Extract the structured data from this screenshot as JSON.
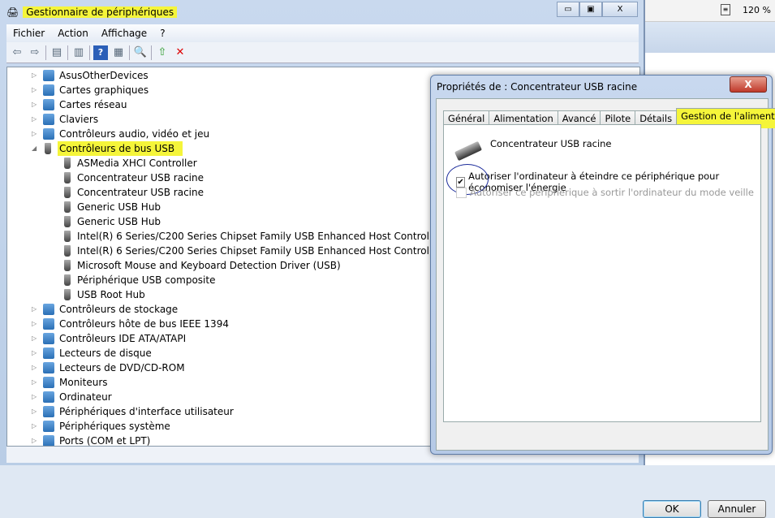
{
  "background": {
    "zoom_level": "120 %"
  },
  "window": {
    "title": "Gestionnaire de périphériques",
    "controls": [
      "minimize",
      "maximize",
      "close"
    ]
  },
  "menu": [
    "Fichier",
    "Action",
    "Affichage",
    "?"
  ],
  "toolbar": [
    "back-icon",
    "forward-icon",
    "show-hide-console-tree-icon",
    "properties-icon",
    "help-icon",
    "action-pane-icon",
    "scan-hardware-icon",
    "update-driver-icon",
    "uninstall-icon"
  ],
  "tree": {
    "before": [
      "AsusOtherDevices",
      "Cartes graphiques",
      "Cartes réseau",
      "Claviers",
      "Contrôleurs audio, vidéo et jeu"
    ],
    "expanded": "Contrôleurs de bus USB",
    "children": [
      "ASMedia XHCI Controller",
      "Concentrateur USB racine",
      "Concentrateur USB racine",
      "Generic USB Hub",
      "Generic USB Hub",
      "Intel(R) 6 Series/C200 Series Chipset Family USB Enhanced Host Controller - 1C26",
      "Intel(R) 6 Series/C200 Series Chipset Family USB Enhanced Host Controller - 1C2D",
      "Microsoft Mouse and Keyboard Detection Driver (USB)",
      "Périphérique USB composite",
      "USB Root Hub"
    ],
    "after": [
      "Contrôleurs de stockage",
      "Contrôleurs hôte de bus IEEE 1394",
      "Contrôleurs IDE ATA/ATAPI",
      "Lecteurs de disque",
      "Lecteurs de DVD/CD-ROM",
      "Moniteurs",
      "Ordinateur",
      "Périphériques d'interface utilisateur",
      "Périphériques système",
      "Ports (COM et LPT)"
    ]
  },
  "dialog": {
    "title": "Propriétés de : Concentrateur USB racine",
    "close": "X",
    "tabs": [
      "Général",
      "Alimentation",
      "Avancé",
      "Pilote",
      "Détails",
      "Gestion de l'alimentation"
    ],
    "active_tab": "Gestion de l'alimentation",
    "device_name": "Concentrateur USB racine",
    "option1": {
      "label": "Autoriser l'ordinateur à éteindre ce périphérique pour économiser l'énergie",
      "checked": true
    },
    "option2": {
      "label": "Autoriser ce périphérique à sortir l'ordinateur du mode veille",
      "checked": false,
      "enabled": false
    },
    "ok": "OK",
    "cancel": "Annuler"
  },
  "highlight_color": "#f5f53a"
}
